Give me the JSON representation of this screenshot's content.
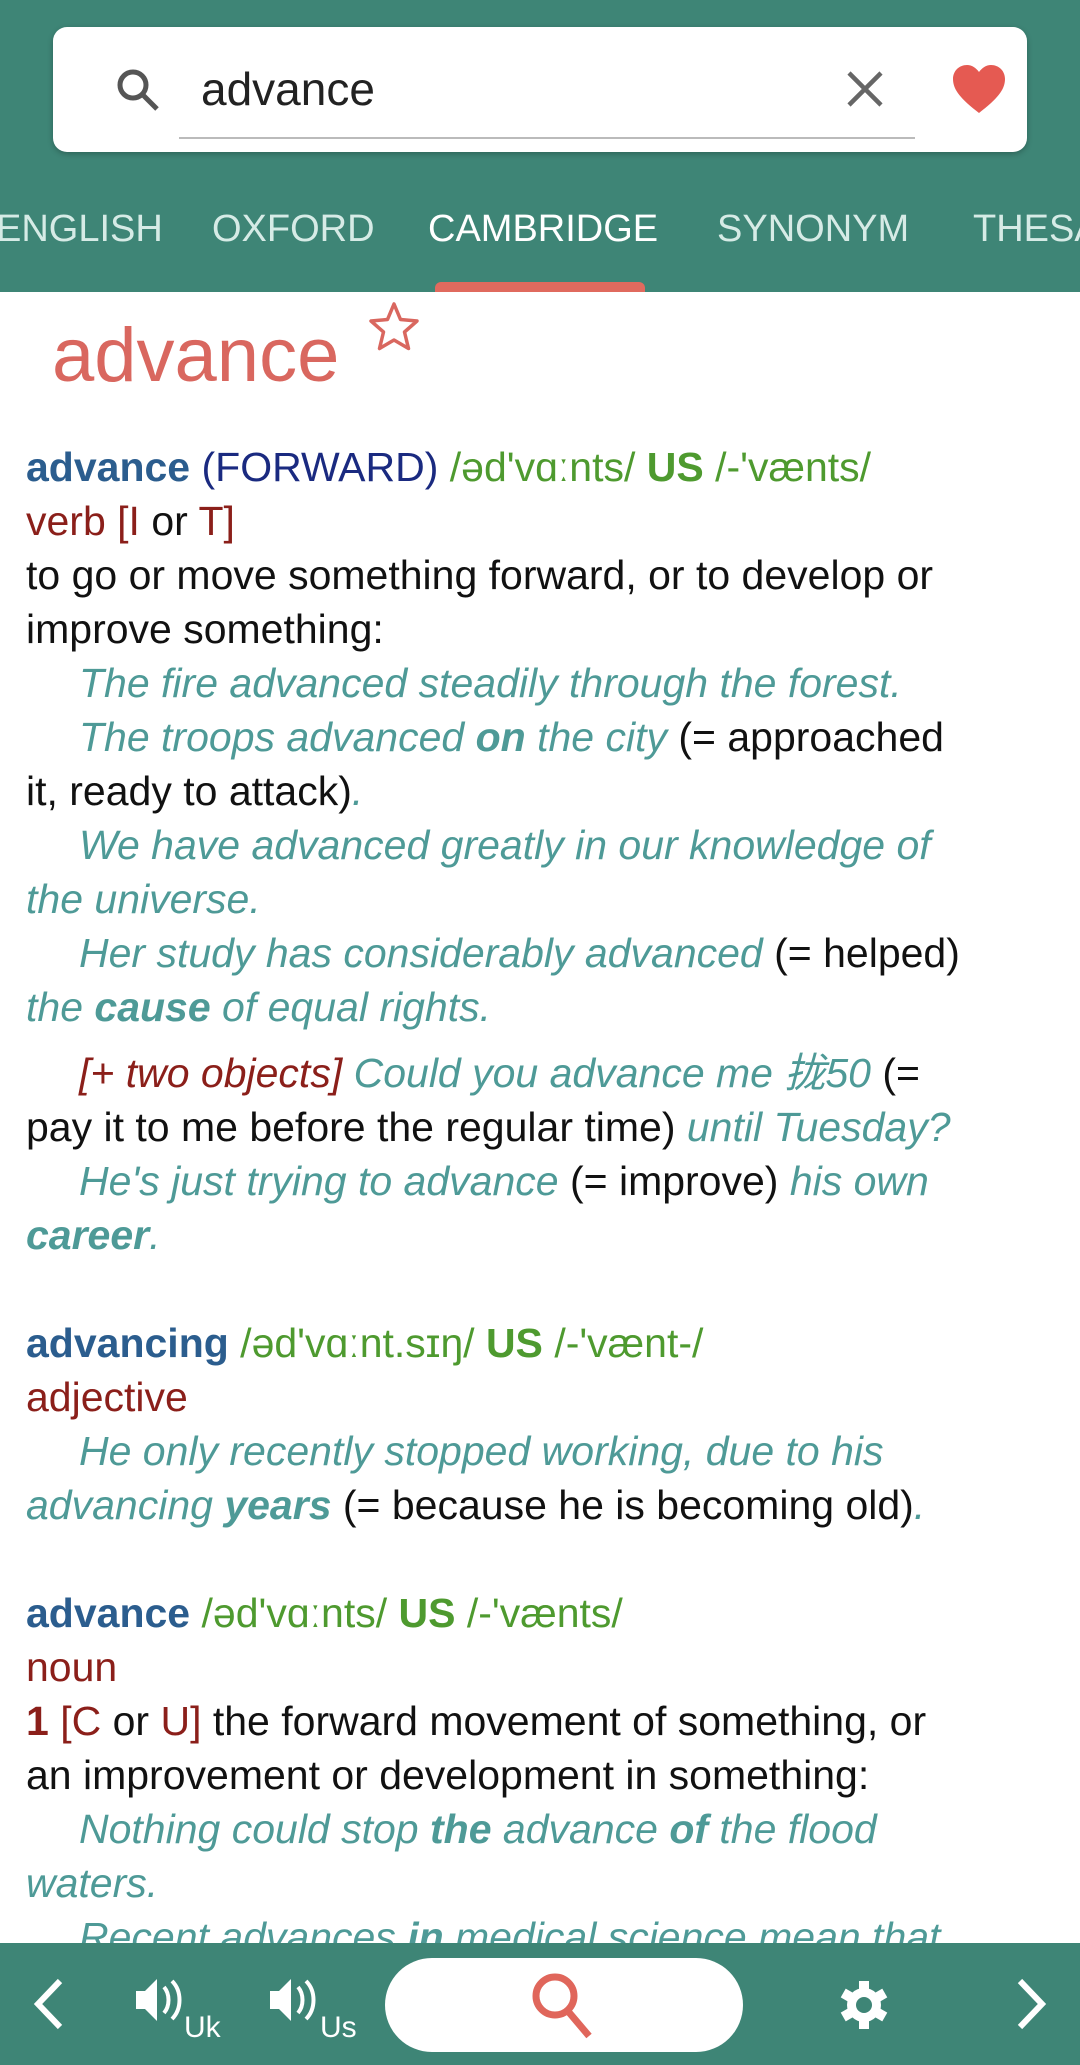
{
  "search": {
    "query": "advance"
  },
  "tabs": [
    {
      "label": "ENGLISH"
    },
    {
      "label": "OXFORD"
    },
    {
      "label": "CAMBRIDGE",
      "active": true
    },
    {
      "label": "SYNONYM"
    },
    {
      "label": "THESA"
    }
  ],
  "entry_title": "advance",
  "colors": {
    "header": "#3e8576",
    "accent": "#e06a5e",
    "title": "#d9675f",
    "headword": "#2b5d8e",
    "phonetic": "#4e9a2f",
    "pos": "#8b1f1a",
    "example": "#4e9a97"
  },
  "lines": [
    {
      "runs": [
        [
          "hw",
          "advance"
        ],
        [
          "gw",
          " (FORWARD)"
        ],
        [
          "ph",
          " /əd'vɑːnts/ "
        ],
        [
          "us",
          "US"
        ],
        [
          "ph",
          " /-'vænts/"
        ]
      ]
    },
    {
      "runs": [
        [
          "pos",
          "verb [I"
        ],
        [
          "def",
          " or "
        ],
        [
          "pos",
          "T]"
        ]
      ]
    },
    {
      "runs": [
        [
          "def",
          "to go or move something forward, or to develop or"
        ]
      ]
    },
    {
      "runs": [
        [
          "def",
          "improve something:"
        ]
      ]
    },
    {
      "ind": true,
      "runs": [
        [
          "ex",
          "The fire advanced steadily through the forest."
        ]
      ]
    },
    {
      "ind": true,
      "runs": [
        [
          "ex",
          "The troops advanced "
        ],
        [
          "exb",
          "on"
        ],
        [
          "ex",
          " the city"
        ],
        [
          "def",
          " (= approached"
        ]
      ]
    },
    {
      "runs": [
        [
          "def",
          "it, ready to attack)"
        ],
        [
          "ex",
          "."
        ]
      ]
    },
    {
      "ind": true,
      "runs": [
        [
          "ex",
          "We have advanced greatly in our knowledge of"
        ]
      ]
    },
    {
      "runs": [
        [
          "ex",
          "the universe."
        ]
      ]
    },
    {
      "ind": true,
      "runs": [
        [
          "ex",
          "Her study has considerably advanced"
        ],
        [
          "def",
          " (= helped)"
        ]
      ]
    },
    {
      "runs": [
        [
          "ex",
          "the "
        ],
        [
          "exb",
          "cause"
        ],
        [
          "ex",
          " of equal rights."
        ]
      ]
    },
    {
      "ind": true,
      "gap": "S",
      "runs": [
        [
          "gi",
          "[+ two objects]"
        ],
        [
          "ex",
          " Could you advance me 拢50"
        ],
        [
          "def",
          " (="
        ]
      ]
    },
    {
      "runs": [
        [
          "def",
          "pay it to me before the regular time)"
        ],
        [
          "ex",
          " until Tuesday?"
        ]
      ]
    },
    {
      "ind": true,
      "runs": [
        [
          "ex",
          "He's just trying to advance"
        ],
        [
          "def",
          " (= improve)"
        ],
        [
          "ex",
          " his own"
        ]
      ]
    },
    {
      "runs": [
        [
          "exb",
          "career"
        ],
        [
          "ex",
          "."
        ]
      ]
    },
    {
      "gap": "L",
      "runs": [
        [
          "hw",
          "advancing"
        ],
        [
          "ph",
          " /əd'vɑːnt.sɪŋ/ "
        ],
        [
          "us",
          "US"
        ],
        [
          "ph",
          " /-'vænt-/"
        ]
      ]
    },
    {
      "runs": [
        [
          "pos",
          "adjective"
        ]
      ]
    },
    {
      "ind": true,
      "runs": [
        [
          "ex",
          "He only recently stopped working, due to his"
        ]
      ]
    },
    {
      "runs": [
        [
          "ex",
          "advancing "
        ],
        [
          "exb",
          "years"
        ],
        [
          "def",
          " (= because he is becoming old)"
        ],
        [
          "ex",
          "."
        ]
      ]
    },
    {
      "gap": "L",
      "runs": [
        [
          "hw",
          "advance"
        ],
        [
          "ph",
          " /əd'vɑːnts/ "
        ],
        [
          "us",
          "US"
        ],
        [
          "ph",
          " /-'vænts/"
        ]
      ]
    },
    {
      "runs": [
        [
          "pos",
          "noun"
        ]
      ]
    },
    {
      "runs": [
        [
          "num",
          "1"
        ],
        [
          "pos",
          " [C"
        ],
        [
          "def",
          " or "
        ],
        [
          "pos",
          "U]"
        ],
        [
          "def",
          " the forward movement of something, or"
        ]
      ]
    },
    {
      "runs": [
        [
          "def",
          "an improvement or development in something:"
        ]
      ]
    },
    {
      "ind": true,
      "runs": [
        [
          "ex",
          "Nothing could stop "
        ],
        [
          "exb",
          "the"
        ],
        [
          "ex",
          " advance "
        ],
        [
          "exb",
          "of"
        ],
        [
          "ex",
          " the flood"
        ]
      ]
    },
    {
      "runs": [
        [
          "ex",
          "waters."
        ]
      ]
    },
    {
      "ind": true,
      "runs": [
        [
          "ex",
          "Recent advances "
        ],
        [
          "exb",
          "in"
        ],
        [
          "ex",
          " medical science mean that"
        ]
      ]
    }
  ],
  "bottom": {
    "uk_label": "Uk",
    "us_label": "Us"
  }
}
